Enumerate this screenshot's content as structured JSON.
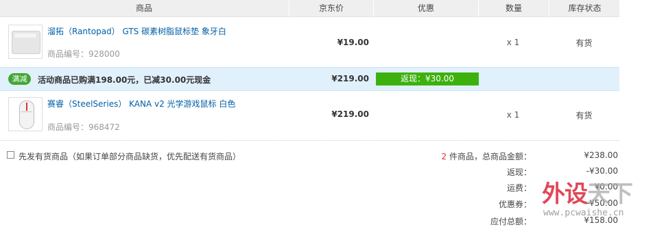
{
  "table": {
    "headers": [
      "商品",
      "京东价",
      "优惠",
      "数量",
      "库存状态"
    ]
  },
  "items": [
    {
      "name": "溜拓（Rantopad） GTS 碳素树脂鼠标垫 象牙白",
      "code": "商品编号：928000",
      "price": "¥19.00",
      "qty": "x 1",
      "stock": "有货",
      "icon": "mousepad-thumbnail"
    },
    {
      "name": "赛睿（SteelSeries） KANA v2 光学游戏鼠标 白色",
      "code": "商品编号：968472",
      "price": "¥219.00",
      "qty": "x 1",
      "stock": "有货",
      "icon": "mouse-thumbnail"
    }
  ],
  "promo": {
    "badge": "满减",
    "text": "活动商品已购满198.00元，已减30.00元现金",
    "price": "¥219.00",
    "cashback": "返现：¥30.00",
    "badge_color": "#42a634",
    "cashback_color": "#3cb10e",
    "background": "#e1f1fc"
  },
  "options": {
    "ship_available_first": "先发有货商品（如果订单部分商品缺货，优先配送有货商品）"
  },
  "summary": {
    "count": "2",
    "count_suffix": " 件商品，总商品金额：",
    "total": "¥238.00",
    "cashback_label": "返现：",
    "cashback_value": "-¥30.00",
    "shipping_label": "运费：",
    "shipping_value": "¥0.00",
    "coupon_label": "优惠券：",
    "coupon_value": "-¥50.00",
    "payable_label": "应付总额：",
    "payable_value": "¥158.00"
  },
  "watermark": {
    "text_a": "外设",
    "text_b": "天下",
    "url": "www.pcwaishe.cn"
  }
}
